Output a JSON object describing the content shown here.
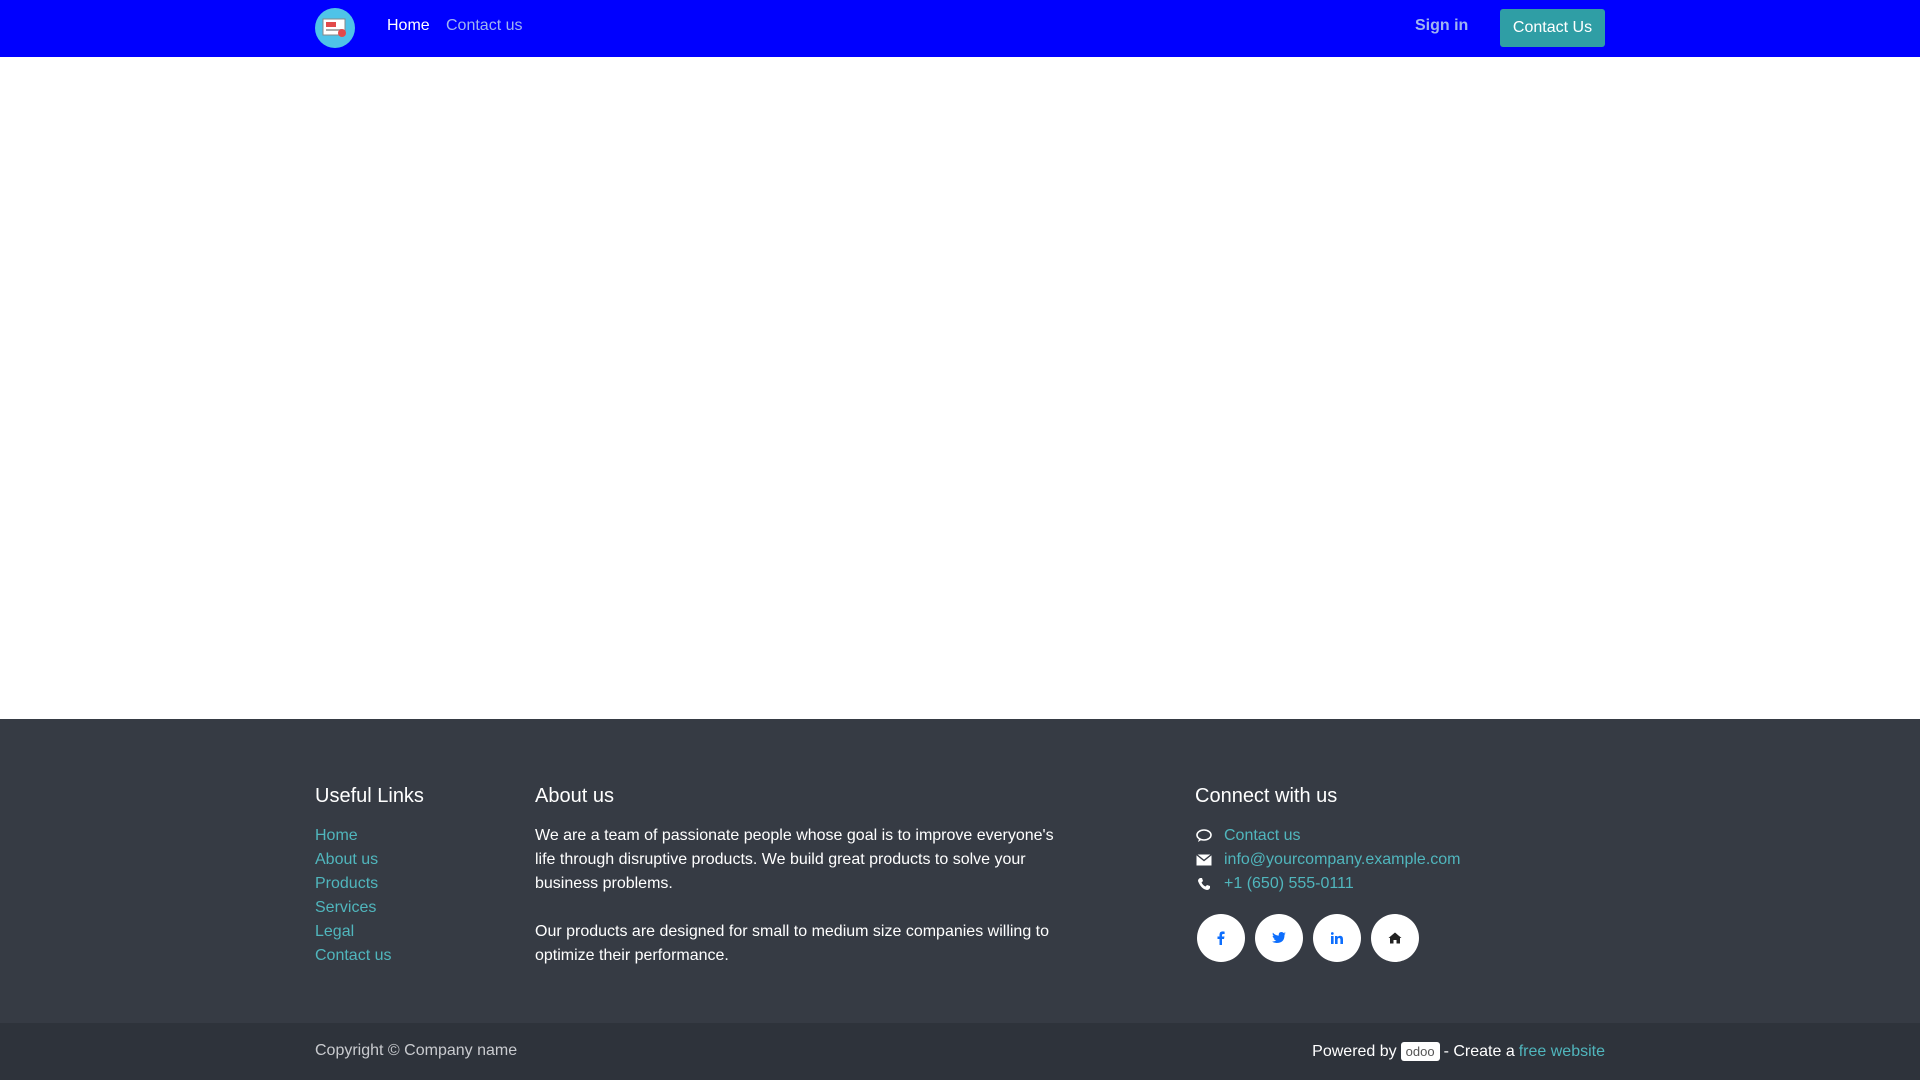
{
  "nav": {
    "home": "Home",
    "contact": "Contact us",
    "signin": "Sign in",
    "cta": "Contact Us"
  },
  "footer": {
    "useful_links_title": "Useful Links",
    "links": [
      "Home",
      "About us",
      "Products",
      "Services",
      "Legal",
      "Contact us"
    ],
    "about_title": "About us",
    "about_p1": "We are a team of passionate people whose goal is to improve everyone's life through disruptive products. We build great products to solve your business problems.",
    "about_p2": "Our products are designed for small to medium size companies willing to optimize their performance.",
    "connect_title": "Connect with us",
    "contact_link": "Contact us",
    "email": "info@yourcompany.example.com",
    "phone": "+1 (650) 555-0111",
    "social_icons": [
      "facebook-icon",
      "twitter-icon",
      "linkedin-icon",
      "home-icon"
    ]
  },
  "copyright": {
    "text": "Copyright © Company name",
    "powered_by": "Powered by",
    "odoo": "odoo",
    "create": "- Create a",
    "free_website": "free website"
  },
  "colors": {
    "navbar": "#0000ff",
    "accent": "#2f9ea5",
    "link": "#50b6bd",
    "footer": "#363b44",
    "copyright_bg": "#2e333b"
  }
}
